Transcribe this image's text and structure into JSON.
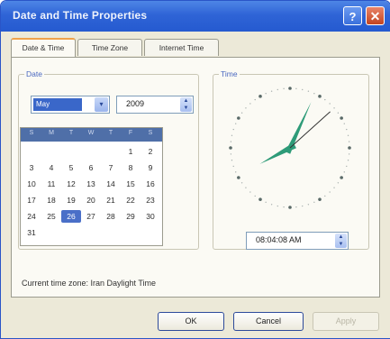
{
  "window": {
    "title": "Date and Time Properties"
  },
  "titlebar": {
    "help_label": "?",
    "close_label": "✕"
  },
  "tabs": [
    {
      "label": "Date & Time",
      "active": true
    },
    {
      "label": "Time Zone",
      "active": false
    },
    {
      "label": "Internet Time",
      "active": false
    }
  ],
  "date_group": {
    "label": "Date",
    "month_value": "May",
    "month_drop_icon": "▾",
    "year_value": "2009",
    "spin_up": "▲",
    "spin_down": "▼"
  },
  "calendar": {
    "weekdays": [
      "S",
      "M",
      "T",
      "W",
      "T",
      "F",
      "S"
    ],
    "weeks": [
      [
        "",
        "",
        "",
        "",
        "",
        "1",
        "2"
      ],
      [
        "3",
        "4",
        "5",
        "6",
        "7",
        "8",
        "9"
      ],
      [
        "10",
        "11",
        "12",
        "13",
        "14",
        "15",
        "16"
      ],
      [
        "17",
        "18",
        "19",
        "20",
        "21",
        "22",
        "23"
      ],
      [
        "24",
        "25",
        "26",
        "27",
        "28",
        "29",
        "30"
      ],
      [
        "31",
        "",
        "",
        "",
        "",
        "",
        ""
      ]
    ],
    "selected_day": "26"
  },
  "time_group": {
    "label": "Time",
    "time_value": "08:04:08 AM",
    "spin_up": "▲",
    "spin_down": "▼"
  },
  "status": {
    "text": "Current time zone: Iran Daylight Time"
  },
  "buttons": {
    "ok": "OK",
    "cancel": "Cancel",
    "apply": "Apply"
  },
  "colors": {
    "titlebar": "#2f64d6",
    "selection": "#4a6fc8",
    "clock_hands": "#2e9b78",
    "dialog_bg": "#ece9d8"
  }
}
